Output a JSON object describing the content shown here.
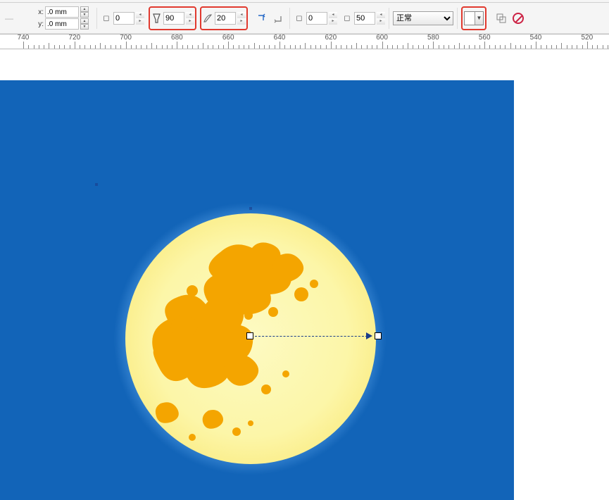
{
  "coords": {
    "x_label": "x:",
    "y_label": "y:",
    "x_value": ".0 mm",
    "y_value": ".0 mm"
  },
  "fields": {
    "lock_value": "0",
    "transparency_value": "90",
    "feather_value": "20",
    "opacity_value": "0",
    "opacity2_value": "50"
  },
  "blend_mode": {
    "options": [
      "正常"
    ],
    "selected": "正常"
  },
  "ruler": {
    "labels": [
      "740",
      "720",
      "700",
      "680",
      "660",
      "640",
      "620",
      "600",
      "580",
      "560",
      "540",
      "520"
    ]
  },
  "highlight_boxes": [
    "transparency-field",
    "feather-field",
    "color-dropdown"
  ],
  "artwork": {
    "description": "moon-on-blue-sky",
    "moon_color": "#fdfac2",
    "sky_color": "#1264b8",
    "crater_color": "#f4a500"
  }
}
